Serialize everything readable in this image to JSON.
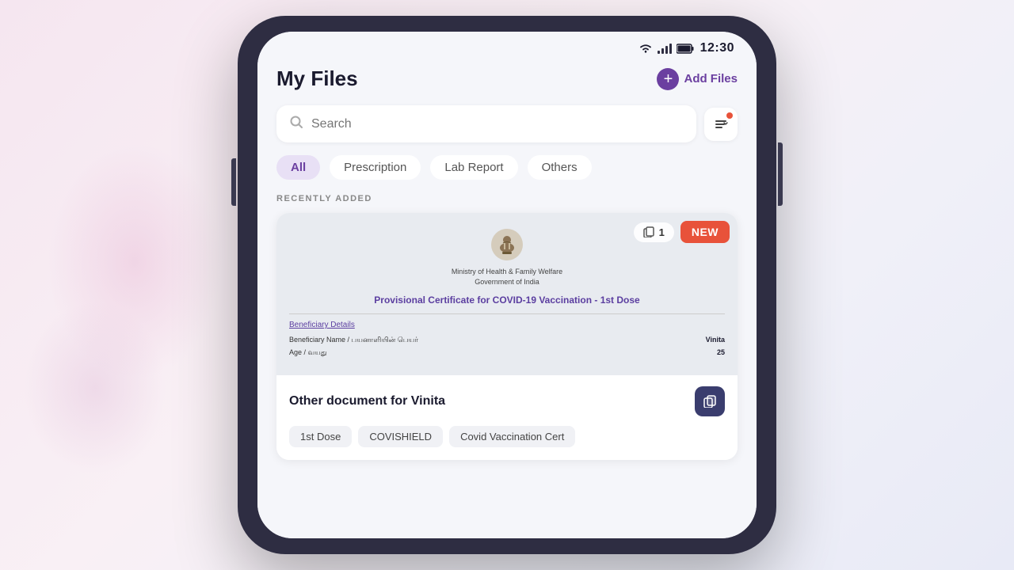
{
  "status_bar": {
    "time": "12:30"
  },
  "header": {
    "title": "My Files",
    "add_files_label": "Add Files"
  },
  "search": {
    "placeholder": "Search"
  },
  "filter_tabs": [
    {
      "label": "All",
      "active": true
    },
    {
      "label": "Prescription",
      "active": false
    },
    {
      "label": "Lab Report",
      "active": false
    },
    {
      "label": "Others",
      "active": false
    }
  ],
  "recently_added": {
    "section_label": "RECENTLY ADDED"
  },
  "document": {
    "ministry_line1": "Ministry of Health & Family Welfare",
    "ministry_line2": "Government of India",
    "cert_title": "Provisional Certificate for COVID-19 Vaccination - 1st Dose",
    "details_label": "Beneficiary Details",
    "name_label": "Beneficiary Name / பயனாளியின் பெயர்",
    "name_value": "Vinita",
    "age_label": "Age / வயது",
    "age_value": "25",
    "pages_count": "1",
    "new_badge": "NEW",
    "footer_name": "Other document for Vinita",
    "tags": [
      "1st Dose",
      "COVISHIELD",
      "Covid Vaccination Cert"
    ]
  }
}
